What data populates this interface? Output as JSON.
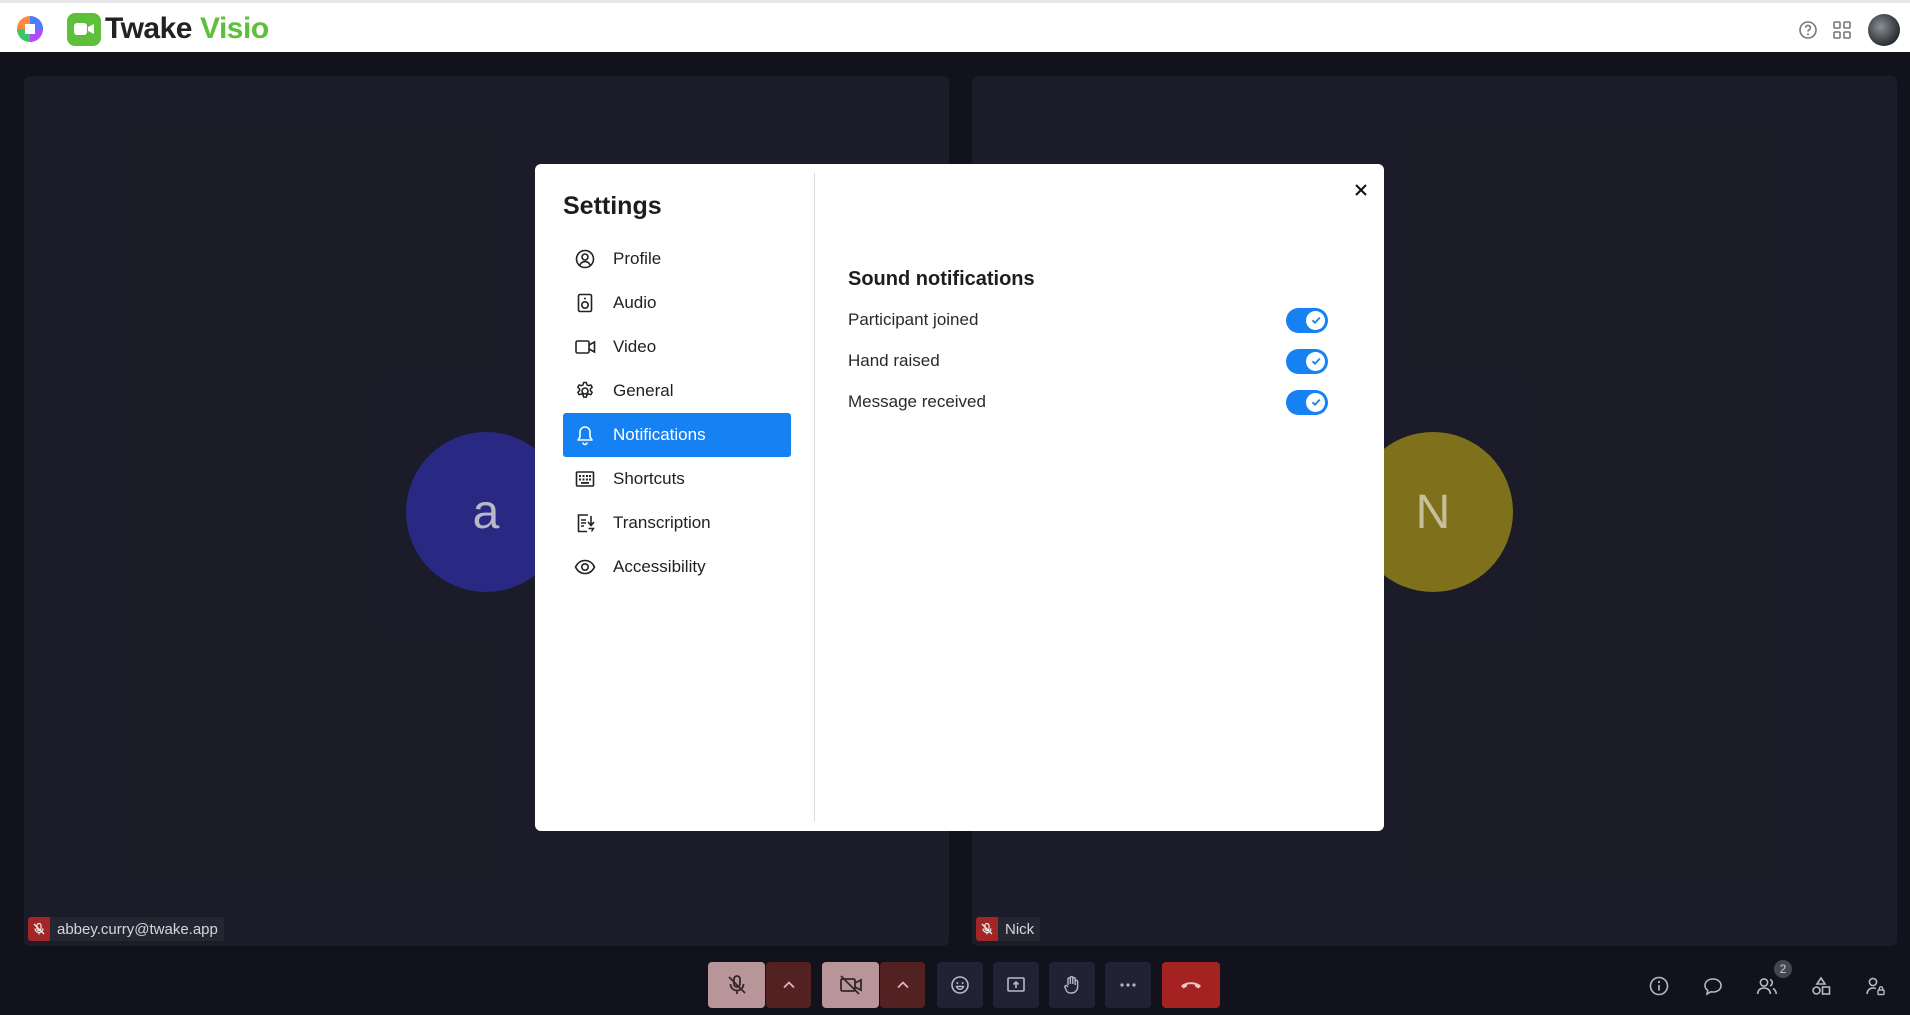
{
  "app": {
    "name_part1": "Twake",
    "name_part2": "Visio"
  },
  "colors": {
    "accent": "#1581f2",
    "brand_green": "#5dbf3a",
    "end_call": "#b32525",
    "muted": "#b02a2a"
  },
  "header": {
    "icons": [
      "help-icon",
      "apps-grid-icon",
      "user-avatar"
    ]
  },
  "participants": [
    {
      "initial": "a",
      "name": "abbey.curry@twake.app",
      "mic": "muted"
    },
    {
      "initial": "N",
      "name": "Nick",
      "mic": "muted"
    }
  ],
  "toolbar": {
    "buttons": [
      "mic-muted-icon",
      "chevron-up-icon",
      "camera-off-icon",
      "chevron-up-icon",
      "emoji-icon",
      "share-screen-icon",
      "raise-hand-icon",
      "more-icon",
      "end-call-icon"
    ],
    "right_icons": [
      "info-icon",
      "chat-icon",
      "participants-icon",
      "activities-icon",
      "admin-icon"
    ],
    "participants_count": "2"
  },
  "settings": {
    "title": "Settings",
    "nav": [
      {
        "label": "Profile",
        "icon": "profile-icon"
      },
      {
        "label": "Audio",
        "icon": "speaker-icon"
      },
      {
        "label": "Video",
        "icon": "video-icon"
      },
      {
        "label": "General",
        "icon": "gear-icon"
      },
      {
        "label": "Notifications",
        "icon": "bell-icon",
        "active": true
      },
      {
        "label": "Shortcuts",
        "icon": "keyboard-icon"
      },
      {
        "label": "Transcription",
        "icon": "transcription-icon"
      },
      {
        "label": "Accessibility",
        "icon": "eye-icon"
      }
    ],
    "section_title": "Sound notifications",
    "toggles": [
      {
        "label": "Participant joined",
        "on": true
      },
      {
        "label": "Hand raised",
        "on": true
      },
      {
        "label": "Message received",
        "on": true
      }
    ]
  }
}
